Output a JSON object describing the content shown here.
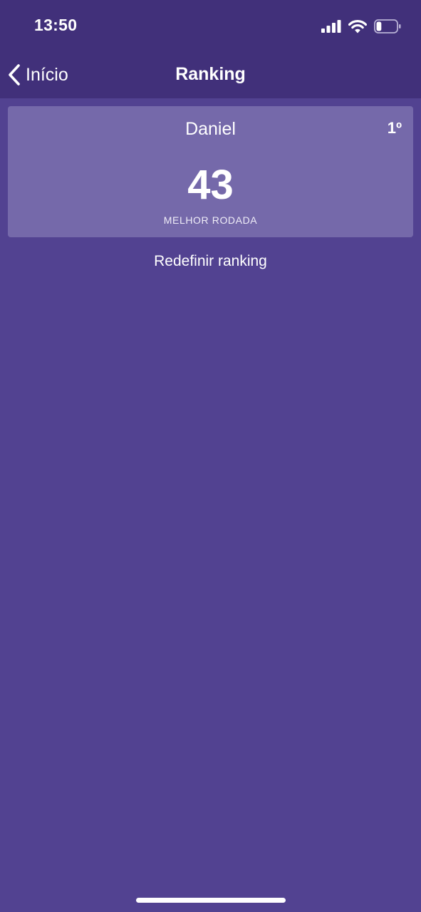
{
  "status_bar": {
    "time": "13:50",
    "icons": [
      "signal-icon",
      "wifi-icon",
      "battery-icon"
    ],
    "battery_level": 0.25
  },
  "nav": {
    "back_label": "Início",
    "title": "Ranking"
  },
  "ranking": {
    "entries": [
      {
        "name": "Daniel",
        "position": "1º",
        "score": "43",
        "score_caption": "MELHOR RODADA"
      }
    ]
  },
  "actions": {
    "reset_label": "Redefinir ranking"
  },
  "colors": {
    "background": "#524291",
    "header": "#41307a",
    "card": "#7569aa",
    "text": "#ffffff"
  }
}
